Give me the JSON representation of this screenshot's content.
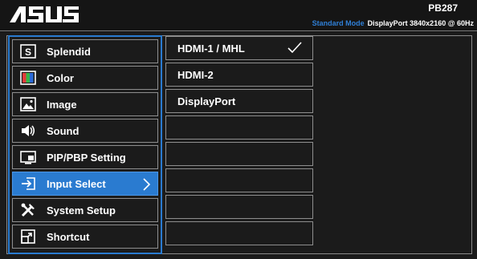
{
  "header": {
    "brand": "ASUS",
    "model": "PB287",
    "mode": "Standard Mode",
    "signal_info": "DisplayPort  3840x2160 @ 60Hz",
    "accent_color": "#2a7bd0"
  },
  "menu": {
    "items": [
      {
        "label": "Splendid",
        "icon": "splendid-icon"
      },
      {
        "label": "Color",
        "icon": "color-icon"
      },
      {
        "label": "Image",
        "icon": "image-icon"
      },
      {
        "label": "Sound",
        "icon": "speaker-icon"
      },
      {
        "label": "PIP/PBP Setting",
        "icon": "pip-icon"
      },
      {
        "label": "Input Select",
        "icon": "input-select-icon",
        "selected": true
      },
      {
        "label": "System Setup",
        "icon": "tools-icon"
      },
      {
        "label": "Shortcut",
        "icon": "shortcut-icon"
      }
    ]
  },
  "submenu": {
    "items": [
      {
        "label": "HDMI-1 / MHL",
        "checked": true
      },
      {
        "label": "HDMI-2"
      },
      {
        "label": "DisplayPort"
      },
      {
        "label": ""
      },
      {
        "label": ""
      },
      {
        "label": ""
      },
      {
        "label": ""
      },
      {
        "label": ""
      }
    ]
  }
}
